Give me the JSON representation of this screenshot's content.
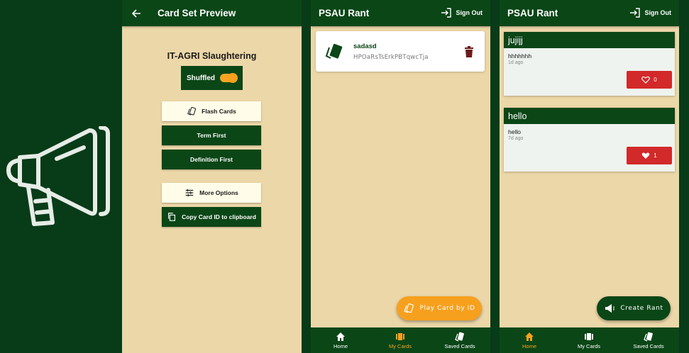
{
  "preview": {
    "title": "Card Set Preview",
    "set_title": "IT-AGRI Slaughtering",
    "shuffle_label": "Shuffled",
    "flash_cards": "Flash Cards",
    "term_first": "Term First",
    "definition_first": "Definition First",
    "more_options": "More Options",
    "copy_id": "Copy Card ID to clipboard"
  },
  "mycards": {
    "title": "PSAU Rant",
    "signout": "Sign Out",
    "card": {
      "name": "sadasd",
      "id": "HPOaRsTsErkPBTqwcTja"
    },
    "fab_label": "Play Card by ID",
    "nav": {
      "home": "Home",
      "mycards": "My Cards",
      "saved": "Saved Cards"
    },
    "active_tab": "My Cards"
  },
  "home": {
    "title": "PSAU Rant",
    "signout": "Sign Out",
    "rants": [
      {
        "title": "jujijj",
        "body": "hhhhhhh",
        "time": "1d ago",
        "likes": "0",
        "liked": false
      },
      {
        "title": "hello",
        "body": "hello",
        "time": "7d ago",
        "likes": "1",
        "liked": true
      }
    ],
    "fab_label": "Create Rant",
    "nav": {
      "home": "Home",
      "mycards": "My Cards",
      "saved": "Saved Cards"
    },
    "active_tab": "Home"
  },
  "colors": {
    "primary": "#0b4617",
    "background": "#ecd7a8",
    "accent": "#f7a01e",
    "like": "#d2292a"
  }
}
